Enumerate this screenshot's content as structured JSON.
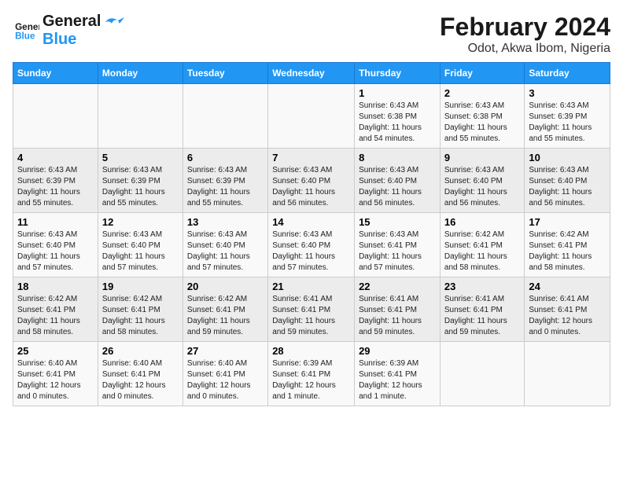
{
  "logo": {
    "line1": "General",
    "line2": "Blue"
  },
  "title": "February 2024",
  "subtitle": "Odot, Akwa Ibom, Nigeria",
  "days_header": [
    "Sunday",
    "Monday",
    "Tuesday",
    "Wednesday",
    "Thursday",
    "Friday",
    "Saturday"
  ],
  "weeks": [
    [
      {
        "num": "",
        "info": ""
      },
      {
        "num": "",
        "info": ""
      },
      {
        "num": "",
        "info": ""
      },
      {
        "num": "",
        "info": ""
      },
      {
        "num": "1",
        "info": "Sunrise: 6:43 AM\nSunset: 6:38 PM\nDaylight: 11 hours and 54 minutes."
      },
      {
        "num": "2",
        "info": "Sunrise: 6:43 AM\nSunset: 6:38 PM\nDaylight: 11 hours and 55 minutes."
      },
      {
        "num": "3",
        "info": "Sunrise: 6:43 AM\nSunset: 6:39 PM\nDaylight: 11 hours and 55 minutes."
      }
    ],
    [
      {
        "num": "4",
        "info": "Sunrise: 6:43 AM\nSunset: 6:39 PM\nDaylight: 11 hours and 55 minutes."
      },
      {
        "num": "5",
        "info": "Sunrise: 6:43 AM\nSunset: 6:39 PM\nDaylight: 11 hours and 55 minutes."
      },
      {
        "num": "6",
        "info": "Sunrise: 6:43 AM\nSunset: 6:39 PM\nDaylight: 11 hours and 55 minutes."
      },
      {
        "num": "7",
        "info": "Sunrise: 6:43 AM\nSunset: 6:40 PM\nDaylight: 11 hours and 56 minutes."
      },
      {
        "num": "8",
        "info": "Sunrise: 6:43 AM\nSunset: 6:40 PM\nDaylight: 11 hours and 56 minutes."
      },
      {
        "num": "9",
        "info": "Sunrise: 6:43 AM\nSunset: 6:40 PM\nDaylight: 11 hours and 56 minutes."
      },
      {
        "num": "10",
        "info": "Sunrise: 6:43 AM\nSunset: 6:40 PM\nDaylight: 11 hours and 56 minutes."
      }
    ],
    [
      {
        "num": "11",
        "info": "Sunrise: 6:43 AM\nSunset: 6:40 PM\nDaylight: 11 hours and 57 minutes."
      },
      {
        "num": "12",
        "info": "Sunrise: 6:43 AM\nSunset: 6:40 PM\nDaylight: 11 hours and 57 minutes."
      },
      {
        "num": "13",
        "info": "Sunrise: 6:43 AM\nSunset: 6:40 PM\nDaylight: 11 hours and 57 minutes."
      },
      {
        "num": "14",
        "info": "Sunrise: 6:43 AM\nSunset: 6:40 PM\nDaylight: 11 hours and 57 minutes."
      },
      {
        "num": "15",
        "info": "Sunrise: 6:43 AM\nSunset: 6:41 PM\nDaylight: 11 hours and 57 minutes."
      },
      {
        "num": "16",
        "info": "Sunrise: 6:42 AM\nSunset: 6:41 PM\nDaylight: 11 hours and 58 minutes."
      },
      {
        "num": "17",
        "info": "Sunrise: 6:42 AM\nSunset: 6:41 PM\nDaylight: 11 hours and 58 minutes."
      }
    ],
    [
      {
        "num": "18",
        "info": "Sunrise: 6:42 AM\nSunset: 6:41 PM\nDaylight: 11 hours and 58 minutes."
      },
      {
        "num": "19",
        "info": "Sunrise: 6:42 AM\nSunset: 6:41 PM\nDaylight: 11 hours and 58 minutes."
      },
      {
        "num": "20",
        "info": "Sunrise: 6:42 AM\nSunset: 6:41 PM\nDaylight: 11 hours and 59 minutes."
      },
      {
        "num": "21",
        "info": "Sunrise: 6:41 AM\nSunset: 6:41 PM\nDaylight: 11 hours and 59 minutes."
      },
      {
        "num": "22",
        "info": "Sunrise: 6:41 AM\nSunset: 6:41 PM\nDaylight: 11 hours and 59 minutes."
      },
      {
        "num": "23",
        "info": "Sunrise: 6:41 AM\nSunset: 6:41 PM\nDaylight: 11 hours and 59 minutes."
      },
      {
        "num": "24",
        "info": "Sunrise: 6:41 AM\nSunset: 6:41 PM\nDaylight: 12 hours and 0 minutes."
      }
    ],
    [
      {
        "num": "25",
        "info": "Sunrise: 6:40 AM\nSunset: 6:41 PM\nDaylight: 12 hours and 0 minutes."
      },
      {
        "num": "26",
        "info": "Sunrise: 6:40 AM\nSunset: 6:41 PM\nDaylight: 12 hours and 0 minutes."
      },
      {
        "num": "27",
        "info": "Sunrise: 6:40 AM\nSunset: 6:41 PM\nDaylight: 12 hours and 0 minutes."
      },
      {
        "num": "28",
        "info": "Sunrise: 6:39 AM\nSunset: 6:41 PM\nDaylight: 12 hours and 1 minute."
      },
      {
        "num": "29",
        "info": "Sunrise: 6:39 AM\nSunset: 6:41 PM\nDaylight: 12 hours and 1 minute."
      },
      {
        "num": "",
        "info": ""
      },
      {
        "num": "",
        "info": ""
      }
    ]
  ]
}
